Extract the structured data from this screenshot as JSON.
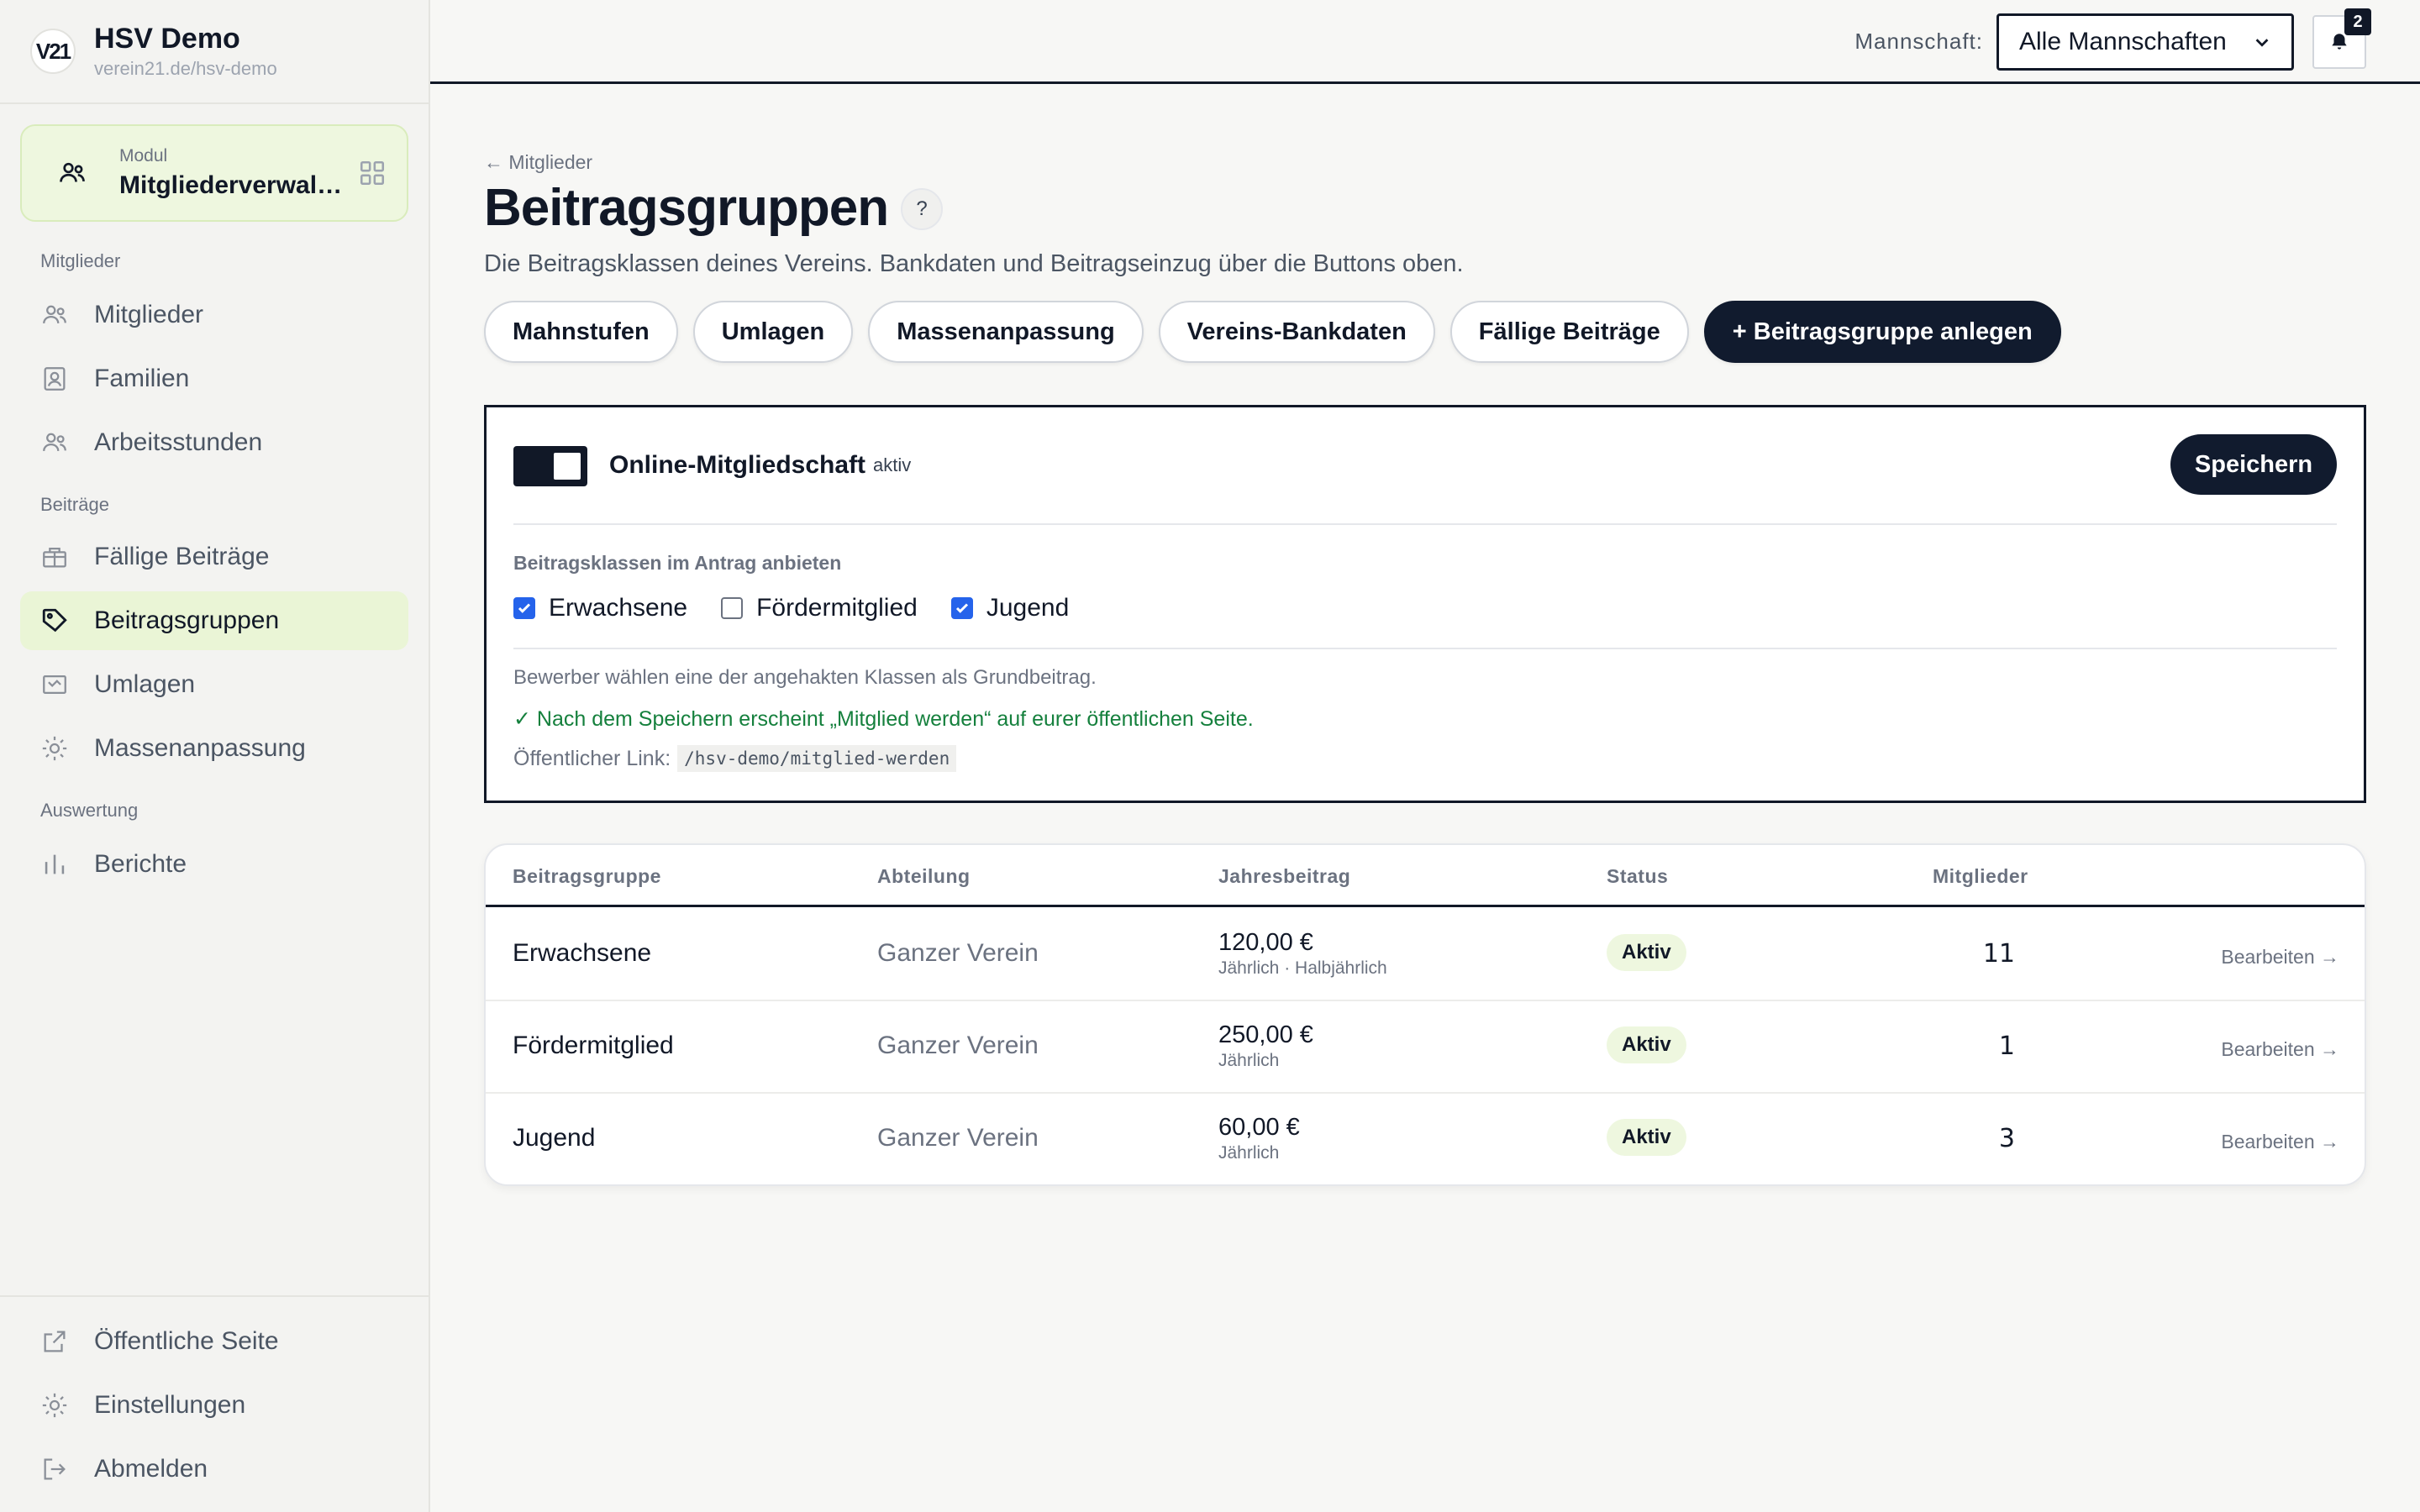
{
  "brand": {
    "logo": "V21",
    "name": "HSV Demo",
    "url": "verein21.de/hsv-demo"
  },
  "module": {
    "label": "Modul",
    "title": "Mitgliederverwaltung",
    "icon": "users-icon"
  },
  "sidebar": {
    "sections": [
      {
        "label": "Mitglieder",
        "items": [
          {
            "label": "Mitglieder",
            "icon": "users-icon"
          },
          {
            "label": "Familien",
            "icon": "family-icon"
          },
          {
            "label": "Arbeitsstunden",
            "icon": "users-icon"
          }
        ]
      },
      {
        "label": "Beiträge",
        "items": [
          {
            "label": "Fällige Beiträge",
            "icon": "gift-icon"
          },
          {
            "label": "Beitragsgruppen",
            "icon": "tag-icon",
            "active": true
          },
          {
            "label": "Umlagen",
            "icon": "ticket-icon"
          },
          {
            "label": "Massenanpassung",
            "icon": "sun-icon"
          }
        ]
      },
      {
        "label": "Auswertung",
        "items": [
          {
            "label": "Berichte",
            "icon": "bar-chart-icon"
          }
        ]
      }
    ],
    "bottom": [
      {
        "label": "Öffentliche Seite",
        "icon": "external-link-icon"
      },
      {
        "label": "Einstellungen",
        "icon": "settings-icon"
      },
      {
        "label": "Abmelden",
        "icon": "logout-icon"
      }
    ]
  },
  "topbar": {
    "team_label": "Mannschaft:",
    "team_value": "Alle Mannschaften",
    "notification_count": "2"
  },
  "page": {
    "back": "← Mitglieder",
    "title": "Beitragsgruppen",
    "help": "?",
    "subtitle": "Die Beitragsklassen deines Vereins. Bankdaten und Beitragseinzug über die Buttons oben.",
    "buttons": [
      "Mahnstufen",
      "Umlagen",
      "Massenanpassung",
      "Vereins-Bankdaten",
      "Fällige Beiträge"
    ],
    "primary_button": "+ Beitragsgruppe anlegen"
  },
  "online": {
    "title": "Online-Mitgliedschaft",
    "status": "aktiv",
    "save": "Speichern",
    "section_label": "Beitragsklassen im Antrag anbieten",
    "options": [
      {
        "label": "Erwachsene",
        "checked": true
      },
      {
        "label": "Fördermitglied",
        "checked": false
      },
      {
        "label": "Jugend",
        "checked": true
      }
    ],
    "note": "Bewerber wählen eine der angehakten Klassen als Grundbeitrag.",
    "success": "✓ Nach dem Speichern erscheint „Mitglied werden“ auf eurer öffentlichen Seite.",
    "link_label": "Öffentlicher Link:",
    "link_value": "/hsv-demo/mitglied-werden"
  },
  "table": {
    "headers": [
      "Beitragsgruppe",
      "Abteilung",
      "Jahresbeitrag",
      "Status",
      "Mitglieder"
    ],
    "rows": [
      {
        "name": "Erwachsene",
        "dept": "Ganzer Verein",
        "fee": "120,00 €",
        "interval": "Jährlich · Halbjährlich",
        "status": "Aktiv",
        "count": "11",
        "edit": "Bearbeiten →"
      },
      {
        "name": "Fördermitglied",
        "dept": "Ganzer Verein",
        "fee": "250,00 €",
        "interval": "Jährlich",
        "status": "Aktiv",
        "count": "1",
        "edit": "Bearbeiten →"
      },
      {
        "name": "Jugend",
        "dept": "Ganzer Verein",
        "fee": "60,00 €",
        "interval": "Jährlich",
        "status": "Aktiv",
        "count": "3",
        "edit": "Bearbeiten →"
      }
    ]
  }
}
